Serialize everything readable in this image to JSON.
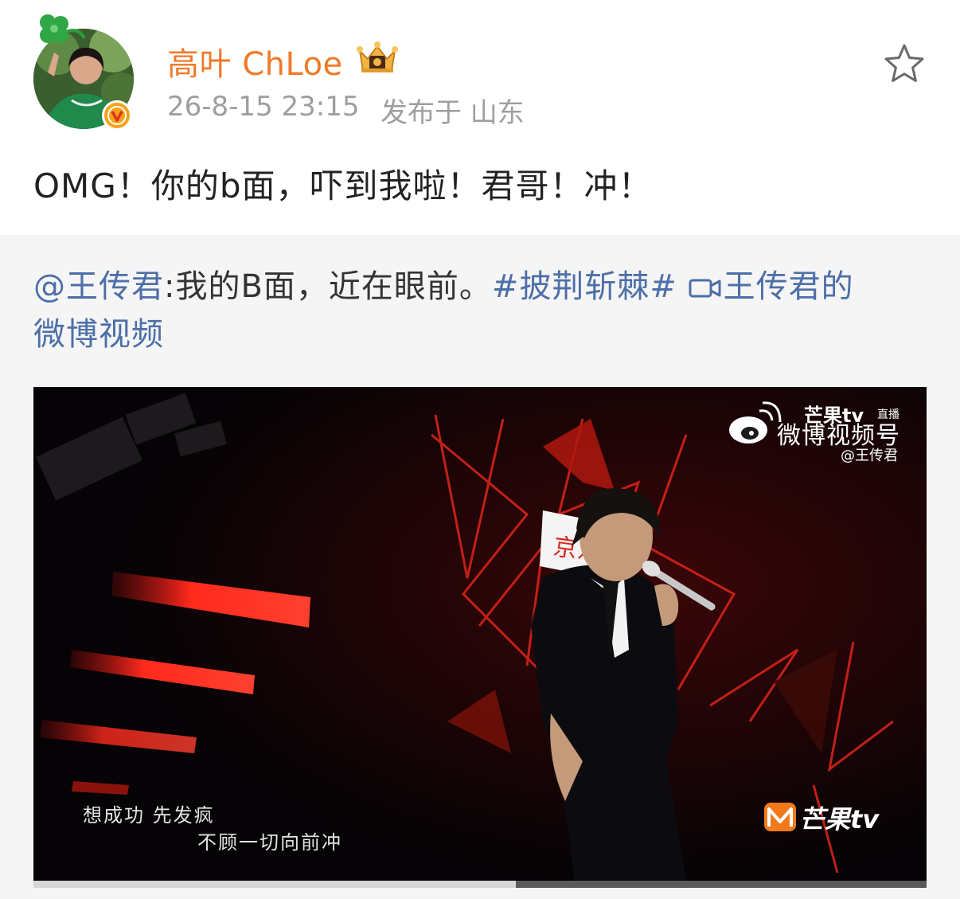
{
  "post": {
    "user_name": "高叶 ChLoe",
    "time": "26-8-15 23:15",
    "location": "发布于 山东",
    "text": "OMG！你的b面，吓到我啦！君哥！冲！"
  },
  "repost": {
    "mention": "@王传君",
    "body": ":我的B面，近在眼前。",
    "hashtag": "#披荆斩棘#",
    "video_link_line1": "王传君的",
    "video_link_line2": "微博视频"
  },
  "video": {
    "watermark_brand": "芒果tv",
    "watermark_live": "直播",
    "watermark_main": "微博视频号",
    "watermark_handle": "@王传君",
    "banner_text": "京东",
    "logo_text": "芒果tv",
    "subtitle_line1": "想成功 先发疯",
    "subtitle_line2": "不顾一切向前冲",
    "progress": 0.54
  },
  "icons": {
    "avatar_decoration": "clover-icon",
    "verified": "verified-v-icon",
    "member": "crown-icon",
    "favorite": "star-outline-icon",
    "video_link": "video-camera-icon",
    "weibo": "weibo-logo-icon"
  },
  "colors": {
    "username": "#ef7a28",
    "link": "#4d6fa8",
    "meta": "#9e9e9e",
    "text": "#222222",
    "repost_bg": "#f5f5f5"
  }
}
